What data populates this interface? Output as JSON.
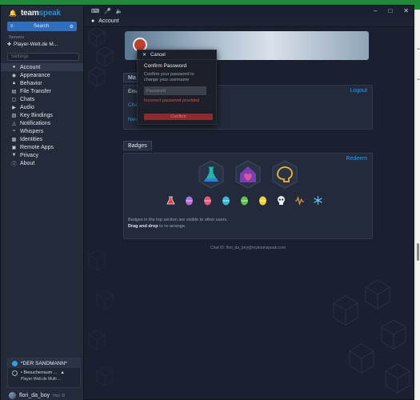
{
  "app": {
    "logo_part1": "team",
    "logo_part2": "speak",
    "search_label": "Search",
    "servers_label": "Servers",
    "server_name": "Player-Welt.de M...",
    "settings_placeholder": "Settings"
  },
  "sidebar": {
    "items": [
      {
        "label": "Account",
        "icon": "user-icon"
      },
      {
        "label": "Appearance",
        "icon": "palette-icon"
      },
      {
        "label": "Behavior",
        "icon": "behavior-icon"
      },
      {
        "label": "File Transfer",
        "icon": "file-icon"
      },
      {
        "label": "Chats",
        "icon": "chat-icon"
      },
      {
        "label": "Audio",
        "icon": "speaker-icon"
      },
      {
        "label": "Key Bindings",
        "icon": "keyboard-icon"
      },
      {
        "label": "Notifications",
        "icon": "bell-icon"
      },
      {
        "label": "Whispers",
        "icon": "whisper-icon"
      },
      {
        "label": "Identities",
        "icon": "id-icon"
      },
      {
        "label": "Remote Apps",
        "icon": "remote-icon"
      },
      {
        "label": "Privacy",
        "icon": "shield-icon"
      },
      {
        "label": "About",
        "icon": "info-icon"
      }
    ]
  },
  "bottom_panel": {
    "channel": "*DER SANDMANN*",
    "sub_channel": "• Besucherraum ...",
    "server": "Player-Welt.de Multi ..."
  },
  "user": {
    "name": "flori_da_boy",
    "status": "Hey :D"
  },
  "titlebar": {
    "title": "Account"
  },
  "account": {
    "section_title": "Ma",
    "email_label": "Ema",
    "logout": "Logout",
    "change_label": "Cha",
    "recovery_link": "New Recovery Key"
  },
  "badges": {
    "section_title": "Badges",
    "redeem": "Redeem",
    "note1": "Badges in the top section are visible to other users.",
    "note2_bold": "Drag and drop",
    "note2_rest": " to re-arrange.",
    "chat_id": "Chat ID: flori_da_boy@myteamspeak.com"
  },
  "popup": {
    "cancel": "Cancel",
    "title": "Confirm Password",
    "desc": "Confirm your password to change your username",
    "input_placeholder": "Password",
    "error": "Incorrect password provided",
    "confirm": "Confirm"
  },
  "colors": {
    "accent": "#2f9ae5",
    "error": "#e0524c",
    "confirm_bg": "#8e2b30"
  }
}
